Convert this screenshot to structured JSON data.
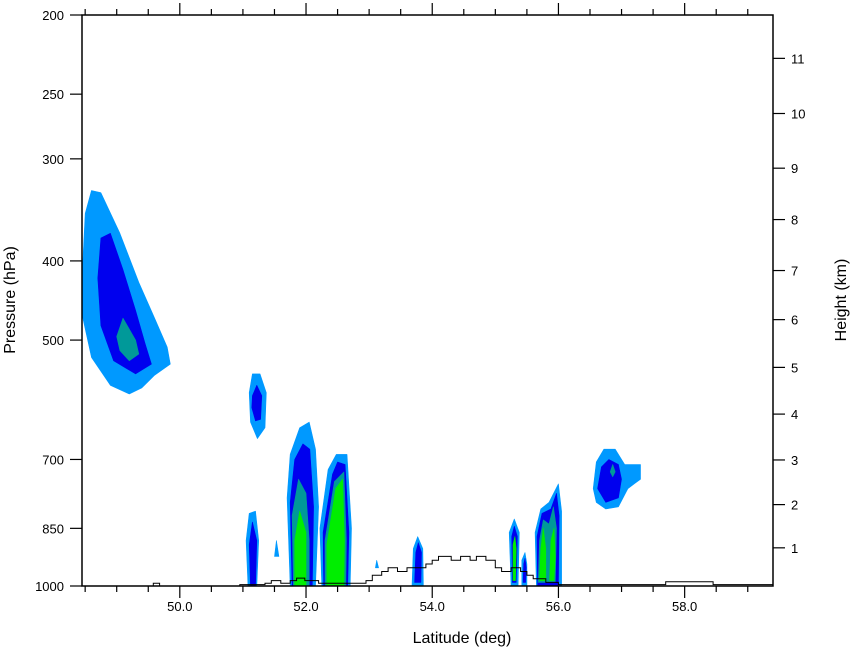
{
  "chart_data": {
    "type": "contour",
    "xlabel": "Latitude (deg)",
    "ylabel_left": "Pressure (hPa)",
    "ylabel_right": "Height (km)",
    "xlim": [
      48.45,
      59.4
    ],
    "ylim_pressure": [
      1000,
      200
    ],
    "pressure_scale": "log",
    "x_ticks": [
      {
        "v": 50,
        "label": "50.0"
      },
      {
        "v": 52,
        "label": "52.0"
      },
      {
        "v": 54,
        "label": "54.0"
      },
      {
        "v": 56,
        "label": "56.0"
      },
      {
        "v": 58,
        "label": "58.0"
      }
    ],
    "x_minor_step": 0.5,
    "pressure_ticks": [
      {
        "p": 200,
        "label": "200"
      },
      {
        "p": 250,
        "label": "250"
      },
      {
        "p": 300,
        "label": "300"
      },
      {
        "p": 400,
        "label": "400"
      },
      {
        "p": 500,
        "label": "500"
      },
      {
        "p": 700,
        "label": "700"
      },
      {
        "p": 850,
        "label": "850"
      },
      {
        "p": 1000,
        "label": "1000"
      }
    ],
    "height_ticks": [
      {
        "p": 898,
        "label": "1"
      },
      {
        "p": 795,
        "label": "2"
      },
      {
        "p": 701,
        "label": "3"
      },
      {
        "p": 616,
        "label": "4"
      },
      {
        "p": 540,
        "label": "5"
      },
      {
        "p": 472,
        "label": "6"
      },
      {
        "p": 411,
        "label": "7"
      },
      {
        "p": 356,
        "label": "8"
      },
      {
        "p": 308,
        "label": "9"
      },
      {
        "p": 264,
        "label": "10"
      },
      {
        "p": 226,
        "label": "11"
      }
    ],
    "levels": [
      {
        "name": "level-1",
        "color": "#0099ff"
      },
      {
        "name": "level-2",
        "color": "#0000ee"
      },
      {
        "name": "level-3",
        "color": "#009999"
      },
      {
        "name": "level-4",
        "color": "#00ee00"
      }
    ],
    "cells": [
      {
        "id": "cell-1",
        "level": 0,
        "pts": [
          [
            48.45,
            420
          ],
          [
            48.5,
            350
          ],
          [
            48.6,
            328
          ],
          [
            48.75,
            330
          ],
          [
            49.05,
            370
          ],
          [
            49.35,
            425
          ],
          [
            49.6,
            470
          ],
          [
            49.8,
            510
          ],
          [
            49.85,
            535
          ],
          [
            49.6,
            552
          ],
          [
            49.4,
            572
          ],
          [
            49.2,
            582
          ],
          [
            48.9,
            568
          ],
          [
            48.6,
            525
          ],
          [
            48.45,
            465
          ]
        ]
      },
      {
        "id": "cell-1",
        "level": 1,
        "pts": [
          [
            48.7,
            420
          ],
          [
            48.75,
            375
          ],
          [
            48.9,
            370
          ],
          [
            49.1,
            410
          ],
          [
            49.3,
            460
          ],
          [
            49.45,
            505
          ],
          [
            49.55,
            535
          ],
          [
            49.3,
            550
          ],
          [
            48.95,
            530
          ],
          [
            48.75,
            480
          ]
        ]
      },
      {
        "id": "cell-1",
        "level": 2,
        "pts": [
          [
            49.0,
            495
          ],
          [
            49.1,
            470
          ],
          [
            49.3,
            500
          ],
          [
            49.35,
            520
          ],
          [
            49.2,
            530
          ],
          [
            49.05,
            515
          ]
        ]
      },
      {
        "id": "cell-2",
        "level": 0,
        "pts": [
          [
            51.1,
            580
          ],
          [
            51.15,
            550
          ],
          [
            51.27,
            550
          ],
          [
            51.37,
            580
          ],
          [
            51.35,
            640
          ],
          [
            51.23,
            660
          ],
          [
            51.12,
            630
          ]
        ]
      },
      {
        "id": "cell-2",
        "level": 1,
        "pts": [
          [
            51.15,
            585
          ],
          [
            51.22,
            568
          ],
          [
            51.3,
            585
          ],
          [
            51.28,
            625
          ],
          [
            51.2,
            628
          ],
          [
            51.14,
            605
          ]
        ]
      },
      {
        "id": "cell-3",
        "level": 0,
        "pts": [
          [
            51.08,
            1000
          ],
          [
            51.05,
            880
          ],
          [
            51.1,
            815
          ],
          [
            51.2,
            810
          ],
          [
            51.25,
            880
          ],
          [
            51.22,
            1000
          ]
        ]
      },
      {
        "id": "cell-3",
        "level": 1,
        "pts": [
          [
            51.12,
            1000
          ],
          [
            51.1,
            890
          ],
          [
            51.15,
            835
          ],
          [
            51.22,
            880
          ],
          [
            51.2,
            1000
          ]
        ]
      },
      {
        "id": "cell-4",
        "level": 0,
        "pts": [
          [
            51.5,
            920
          ],
          [
            51.53,
            880
          ],
          [
            51.57,
            920
          ]
        ]
      },
      {
        "id": "cell-5",
        "level": 0,
        "pts": [
          [
            51.75,
            1000
          ],
          [
            51.7,
            780
          ],
          [
            51.75,
            690
          ],
          [
            51.9,
            640
          ],
          [
            52.05,
            630
          ],
          [
            52.15,
            680
          ],
          [
            52.2,
            800
          ],
          [
            52.15,
            1000
          ]
        ]
      },
      {
        "id": "cell-5",
        "level": 1,
        "pts": [
          [
            51.78,
            1000
          ],
          [
            51.75,
            790
          ],
          [
            51.82,
            700
          ],
          [
            51.95,
            670
          ],
          [
            52.06,
            680
          ],
          [
            52.12,
            800
          ],
          [
            52.1,
            1000
          ]
        ]
      },
      {
        "id": "cell-5",
        "level": 2,
        "pts": [
          [
            51.8,
            1000
          ],
          [
            51.78,
            820
          ],
          [
            51.88,
            740
          ],
          [
            52.0,
            770
          ],
          [
            52.05,
            880
          ],
          [
            52.05,
            1000
          ]
        ]
      },
      {
        "id": "cell-5",
        "level": 3,
        "pts": [
          [
            51.82,
            1000
          ],
          [
            51.82,
            880
          ],
          [
            51.9,
            810
          ],
          [
            52.0,
            860
          ],
          [
            52.0,
            1000
          ]
        ]
      },
      {
        "id": "cell-6",
        "level": 0,
        "pts": [
          [
            52.25,
            1000
          ],
          [
            52.22,
            850
          ],
          [
            52.35,
            720
          ],
          [
            52.48,
            690
          ],
          [
            52.65,
            690
          ],
          [
            52.72,
            850
          ],
          [
            52.7,
            1000
          ]
        ]
      },
      {
        "id": "cell-6",
        "level": 1,
        "pts": [
          [
            52.28,
            1000
          ],
          [
            52.27,
            860
          ],
          [
            52.42,
            730
          ],
          [
            52.5,
            705
          ],
          [
            52.62,
            710
          ],
          [
            52.68,
            860
          ],
          [
            52.66,
            1000
          ]
        ]
      },
      {
        "id": "cell-6",
        "level": 2,
        "pts": [
          [
            52.3,
            1000
          ],
          [
            52.3,
            880
          ],
          [
            52.45,
            745
          ],
          [
            52.6,
            725
          ],
          [
            52.64,
            880
          ],
          [
            52.63,
            1000
          ]
        ]
      },
      {
        "id": "cell-6",
        "level": 3,
        "pts": [
          [
            52.33,
            1000
          ],
          [
            52.33,
            890
          ],
          [
            52.47,
            760
          ],
          [
            52.58,
            740
          ],
          [
            52.61,
            880
          ],
          [
            52.6,
            1000
          ]
        ]
      },
      {
        "id": "cell-7",
        "level": 0,
        "pts": [
          [
            53.1,
            950
          ],
          [
            53.12,
            930
          ],
          [
            53.15,
            950
          ]
        ]
      },
      {
        "id": "cell-8",
        "level": 0,
        "pts": [
          [
            53.68,
            1000
          ],
          [
            53.7,
            900
          ],
          [
            53.77,
            870
          ],
          [
            53.85,
            900
          ],
          [
            53.86,
            1000
          ]
        ]
      },
      {
        "id": "cell-8",
        "level": 1,
        "pts": [
          [
            53.72,
            990
          ],
          [
            53.74,
            910
          ],
          [
            53.78,
            885
          ],
          [
            53.83,
            910
          ],
          [
            53.82,
            990
          ]
        ]
      },
      {
        "id": "cell-9",
        "level": 0,
        "pts": [
          [
            55.25,
            1000
          ],
          [
            55.22,
            860
          ],
          [
            55.3,
            828
          ],
          [
            55.38,
            860
          ],
          [
            55.36,
            1000
          ]
        ]
      },
      {
        "id": "cell-9",
        "level": 1,
        "pts": [
          [
            55.27,
            990
          ],
          [
            55.26,
            870
          ],
          [
            55.3,
            845
          ],
          [
            55.35,
            870
          ],
          [
            55.33,
            990
          ]
        ]
      },
      {
        "id": "cell-9",
        "level": 3,
        "pts": [
          [
            55.28,
            985
          ],
          [
            55.28,
            890
          ],
          [
            55.31,
            870
          ],
          [
            55.33,
            900
          ],
          [
            55.32,
            985
          ]
        ]
      },
      {
        "id": "cell-10",
        "level": 0,
        "pts": [
          [
            55.42,
            1000
          ],
          [
            55.42,
            930
          ],
          [
            55.47,
            910
          ],
          [
            55.5,
            940
          ],
          [
            55.5,
            1000
          ]
        ]
      },
      {
        "id": "cell-10",
        "level": 1,
        "pts": [
          [
            55.44,
            990
          ],
          [
            55.45,
            940
          ],
          [
            55.47,
            925
          ],
          [
            55.49,
            950
          ],
          [
            55.48,
            990
          ]
        ]
      },
      {
        "id": "cell-11",
        "level": 0,
        "pts": [
          [
            55.65,
            1000
          ],
          [
            55.63,
            860
          ],
          [
            55.72,
            805
          ],
          [
            55.85,
            790
          ],
          [
            56.0,
            750
          ],
          [
            56.05,
            810
          ],
          [
            56.05,
            1000
          ]
        ]
      },
      {
        "id": "cell-11",
        "level": 1,
        "pts": [
          [
            55.67,
            1000
          ],
          [
            55.66,
            870
          ],
          [
            55.74,
            815
          ],
          [
            55.88,
            805
          ],
          [
            55.97,
            770
          ],
          [
            56.01,
            820
          ],
          [
            56.0,
            1000
          ]
        ]
      },
      {
        "id": "cell-11",
        "level": 2,
        "pts": [
          [
            55.68,
            990
          ],
          [
            55.7,
            880
          ],
          [
            55.76,
            830
          ],
          [
            55.85,
            840
          ],
          [
            55.92,
            800
          ],
          [
            55.97,
            850
          ],
          [
            55.95,
            990
          ]
        ]
      },
      {
        "id": "cell-11",
        "level": 3,
        "pts": [
          [
            55.7,
            985
          ],
          [
            55.72,
            900
          ],
          [
            55.76,
            850
          ],
          [
            55.8,
            900
          ],
          [
            55.8,
            985
          ]
        ]
      },
      {
        "id": "cell-11",
        "level": 3,
        "pts": [
          [
            55.86,
            985
          ],
          [
            55.88,
            880
          ],
          [
            55.93,
            850
          ],
          [
            55.95,
            920
          ],
          [
            55.93,
            985
          ]
        ]
      },
      {
        "id": "cell-12",
        "level": 0,
        "pts": [
          [
            56.55,
            760
          ],
          [
            56.6,
            705
          ],
          [
            56.72,
            680
          ],
          [
            56.9,
            680
          ],
          [
            57.05,
            710
          ],
          [
            57.3,
            710
          ],
          [
            57.3,
            740
          ],
          [
            57.1,
            760
          ],
          [
            56.95,
            800
          ],
          [
            56.75,
            805
          ],
          [
            56.6,
            790
          ]
        ]
      },
      {
        "id": "cell-12",
        "level": 1,
        "pts": [
          [
            56.62,
            760
          ],
          [
            56.68,
            715
          ],
          [
            56.8,
            700
          ],
          [
            56.95,
            710
          ],
          [
            57.0,
            740
          ],
          [
            56.95,
            780
          ],
          [
            56.75,
            790
          ]
        ]
      },
      {
        "id": "cell-12",
        "level": 2,
        "pts": [
          [
            56.82,
            725
          ],
          [
            56.86,
            710
          ],
          [
            56.9,
            725
          ],
          [
            56.86,
            735
          ]
        ]
      }
    ],
    "terrain_line": [
      [
        48.45,
        1000
      ],
      [
        49.58,
        1000
      ],
      [
        49.58,
        992
      ],
      [
        49.68,
        992
      ],
      [
        49.68,
        1000
      ],
      [
        50.95,
        1000
      ],
      [
        50.95,
        996
      ],
      [
        51.35,
        996
      ],
      [
        51.35,
        992
      ],
      [
        51.45,
        992
      ],
      [
        51.45,
        985
      ],
      [
        51.6,
        985
      ],
      [
        51.6,
        992
      ],
      [
        51.75,
        992
      ],
      [
        51.75,
        985
      ],
      [
        51.85,
        985
      ],
      [
        51.85,
        978
      ],
      [
        51.98,
        978
      ],
      [
        51.98,
        985
      ],
      [
        52.2,
        985
      ],
      [
        52.2,
        992
      ],
      [
        52.95,
        992
      ],
      [
        52.95,
        985
      ],
      [
        53.05,
        985
      ],
      [
        53.05,
        970
      ],
      [
        53.2,
        970
      ],
      [
        53.2,
        960
      ],
      [
        53.3,
        960
      ],
      [
        53.3,
        950
      ],
      [
        53.45,
        950
      ],
      [
        53.45,
        960
      ],
      [
        53.6,
        960
      ],
      [
        53.6,
        950
      ],
      [
        53.9,
        950
      ],
      [
        53.9,
        940
      ],
      [
        54.0,
        940
      ],
      [
        54.0,
        930
      ],
      [
        54.1,
        930
      ],
      [
        54.1,
        920
      ],
      [
        54.3,
        920
      ],
      [
        54.3,
        930
      ],
      [
        54.45,
        930
      ],
      [
        54.45,
        920
      ],
      [
        54.6,
        920
      ],
      [
        54.6,
        930
      ],
      [
        54.7,
        930
      ],
      [
        54.7,
        920
      ],
      [
        54.85,
        920
      ],
      [
        54.85,
        930
      ],
      [
        55.0,
        930
      ],
      [
        55.0,
        950
      ],
      [
        55.1,
        950
      ],
      [
        55.1,
        960
      ],
      [
        55.25,
        960
      ],
      [
        55.25,
        950
      ],
      [
        55.4,
        950
      ],
      [
        55.4,
        960
      ],
      [
        55.5,
        960
      ],
      [
        55.5,
        970
      ],
      [
        55.6,
        970
      ],
      [
        55.6,
        980
      ],
      [
        55.8,
        980
      ],
      [
        55.8,
        990
      ],
      [
        56.0,
        990
      ],
      [
        56.0,
        996
      ],
      [
        57.7,
        996
      ],
      [
        57.7,
        988
      ],
      [
        58.45,
        988
      ],
      [
        58.45,
        996
      ],
      [
        59.4,
        996
      ]
    ]
  }
}
